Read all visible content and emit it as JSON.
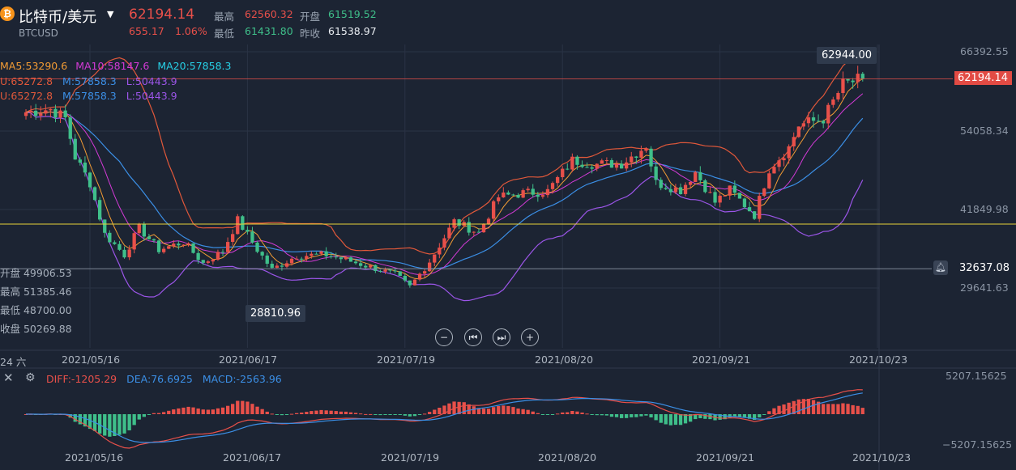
{
  "header": {
    "title": "比特币/美元",
    "symbol": "BTCUSD",
    "last_price": "62194.14",
    "change": "655.17",
    "change_pct": "1.06%",
    "high_label": "最高",
    "high_value": "62560.32",
    "low_label": "最低",
    "low_value": "61431.80",
    "open_label": "开盘",
    "open_value": "61519.52",
    "prev_close_label": "昨收",
    "prev_close_value": "61538.97"
  },
  "legends": {
    "ma5": "MA5:53290.6",
    "ma10": "MA10:58147.6",
    "ma20": "MA20:57858.3",
    "boll1_u": "U:65272.8",
    "boll1_m": "M:57858.3",
    "boll1_l": "L:50443.9",
    "boll2_u": "U:65272.8",
    "boll2_m": "M:57858.3",
    "boll2_l": "L:50443.9"
  },
  "hover_info": {
    "open": "开盘 49906.53",
    "high": "最高 51385.46",
    "low": "最低 48700.00",
    "close": "收盘 50269.88"
  },
  "price_axis": [
    "66392.55",
    "54058.34",
    "41849.98",
    "29641.63"
  ],
  "tags": {
    "current_price": "62194.14",
    "alert_price": "32637.08",
    "max_price": "62944.00",
    "min_price": "28810.96"
  },
  "date_axis": [
    "2021/05/16",
    "2021/06/17",
    "2021/07/19",
    "2021/08/20",
    "2021/09/21",
    "2021/10/23"
  ],
  "crosshair_day": "24 六",
  "macd": {
    "diff": "DIFF:-1205.29",
    "dea": "DEA:76.6925",
    "macd": "MACD:-2563.96",
    "top": "5207.15625",
    "bottom": "−5207.15625"
  },
  "colors": {
    "up": "#e8504a",
    "down": "#3fbf8a",
    "ma5": "#f39c34",
    "ma10": "#d33ad6",
    "ma20": "#27d0e6",
    "boll_upper": "#e0583a",
    "boll_mid": "#3b8fe6",
    "boll_lower": "#9b55e8",
    "diff": "#e8504a",
    "dea": "#3b8fe6"
  },
  "chart_data": {
    "type": "candlestick",
    "title": "比特币/美元",
    "ylim": [
      26000,
      69000
    ],
    "x": [
      "2021/05/16",
      "2021/06/17",
      "2021/07/19",
      "2021/08/20",
      "2021/09/21",
      "2021/10/23"
    ],
    "close_path": [
      {
        "date": "2021/05/03",
        "close": 57000
      },
      {
        "date": "2021/05/08",
        "close": 57500
      },
      {
        "date": "2021/05/11",
        "close": 56000
      },
      {
        "date": "2021/05/13",
        "close": 50000
      },
      {
        "date": "2021/05/16",
        "close": 46000
      },
      {
        "date": "2021/05/19",
        "close": 38000
      },
      {
        "date": "2021/05/23",
        "close": 34800
      },
      {
        "date": "2021/05/26",
        "close": 39000
      },
      {
        "date": "2021/05/30",
        "close": 35600
      },
      {
        "date": "2021/06/04",
        "close": 36800
      },
      {
        "date": "2021/06/08",
        "close": 33500
      },
      {
        "date": "2021/06/12",
        "close": 35400
      },
      {
        "date": "2021/06/15",
        "close": 40200
      },
      {
        "date": "2021/06/19",
        "close": 35600
      },
      {
        "date": "2021/06/22",
        "close": 32500
      },
      {
        "date": "2021/06/27",
        "close": 34700
      },
      {
        "date": "2021/07/03",
        "close": 34800
      },
      {
        "date": "2021/07/08",
        "close": 33800
      },
      {
        "date": "2021/07/13",
        "close": 32700
      },
      {
        "date": "2021/07/17",
        "close": 31700
      },
      {
        "date": "2021/07/20",
        "close": 29800
      },
      {
        "date": "2021/07/24",
        "close": 33800
      },
      {
        "date": "2021/07/29",
        "close": 40000
      },
      {
        "date": "2021/08/03",
        "close": 38200
      },
      {
        "date": "2021/08/07",
        "close": 43800
      },
      {
        "date": "2021/08/12",
        "close": 44400
      },
      {
        "date": "2021/08/17",
        "close": 44700
      },
      {
        "date": "2021/08/22",
        "close": 49500
      },
      {
        "date": "2021/08/27",
        "close": 48900
      },
      {
        "date": "2021/09/01",
        "close": 49000
      },
      {
        "date": "2021/09/06",
        "close": 51800
      },
      {
        "date": "2021/09/08",
        "close": 46000
      },
      {
        "date": "2021/09/13",
        "close": 44900
      },
      {
        "date": "2021/09/16",
        "close": 47700
      },
      {
        "date": "2021/09/20",
        "close": 43000
      },
      {
        "date": "2021/09/23",
        "close": 44900
      },
      {
        "date": "2021/09/28",
        "close": 41000
      },
      {
        "date": "2021/10/01",
        "close": 48200
      },
      {
        "date": "2021/10/05",
        "close": 51500
      },
      {
        "date": "2021/10/07",
        "close": 55000
      },
      {
        "date": "2021/10/12",
        "close": 56000
      },
      {
        "date": "2021/10/16",
        "close": 61300
      },
      {
        "date": "2021/10/20",
        "close": 62194
      }
    ],
    "reference_lines": {
      "max": 62944.0,
      "min": 28810.96,
      "alert": 32637.08,
      "current": 62194.14
    }
  }
}
